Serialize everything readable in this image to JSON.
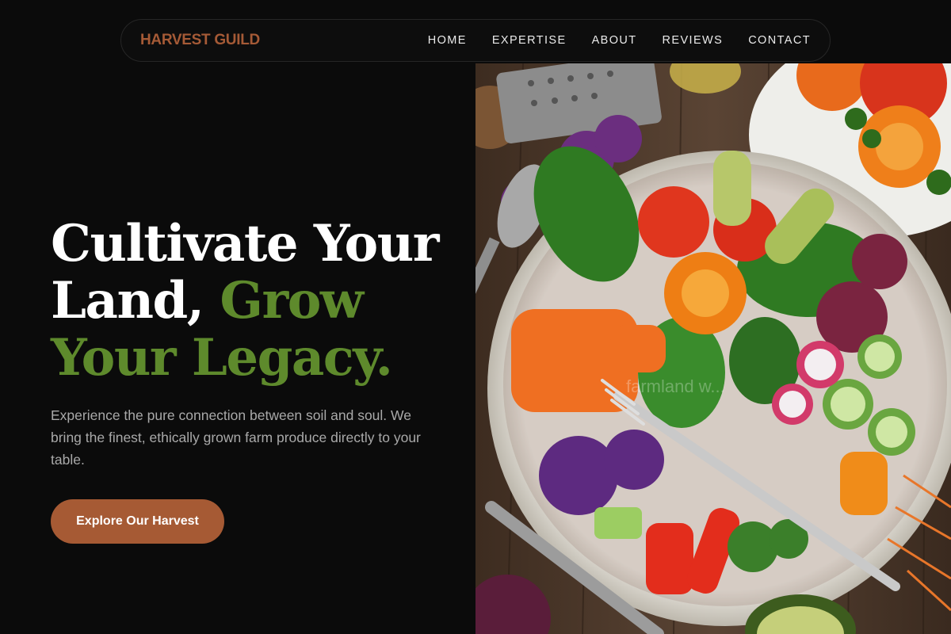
{
  "brand": {
    "logo_text": "HARVEST GUILD",
    "color": "#a55a36"
  },
  "nav": {
    "items": [
      {
        "label": "HOME"
      },
      {
        "label": "EXPERTISE"
      },
      {
        "label": "ABOUT"
      },
      {
        "label": "REVIEWS"
      },
      {
        "label": "CONTACT"
      }
    ]
  },
  "hero": {
    "headline_part1": "Cultivate Your Land,",
    "headline_accent": "Grow Your Legacy.",
    "description": "Experience the pure connection between soil and soul. We bring the finest, ethically grown farm produce directly to your table.",
    "cta_label": "Explore Our Harvest"
  },
  "photo": {
    "subject": "salad-bowl-photo",
    "watermark": "farmland w..."
  },
  "colors": {
    "background": "#0b0b0b",
    "accent_green": "#5e8a2c",
    "accent_rust": "#a65a34"
  }
}
